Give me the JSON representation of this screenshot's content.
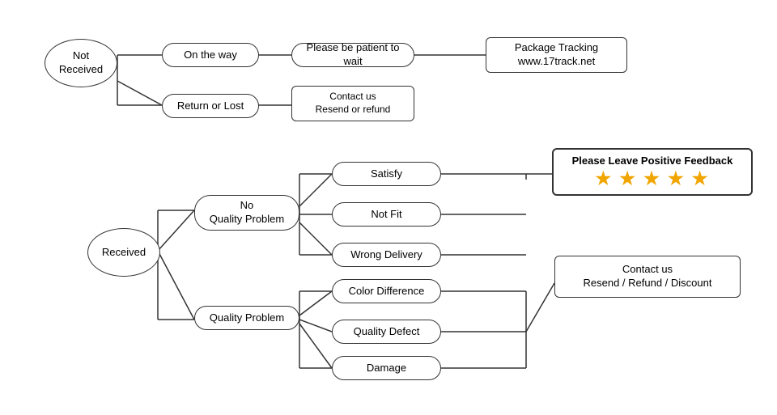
{
  "nodes": {
    "not_received": "Not\nReceived",
    "received": "Received",
    "on_the_way": "On the way",
    "return_or_lost": "Return or Lost",
    "patient": "Please be patient to wait",
    "contact_resend": "Contact us\nResend or refund",
    "package_tracking": "Package Tracking\nwww.17track.net",
    "no_quality_problem": "No\nQuality Problem",
    "quality_problem": "Quality Problem",
    "satisfy": "Satisfy",
    "not_fit": "Not Fit",
    "wrong_delivery": "Wrong Delivery",
    "color_difference": "Color Difference",
    "quality_defect": "Quality Defect",
    "damage": "Damage",
    "please_leave": "Please Leave Positive Feedback",
    "contact_us2": "Contact us\nResend / Refund / Discount",
    "stars": "★ ★ ★ ★ ★"
  }
}
